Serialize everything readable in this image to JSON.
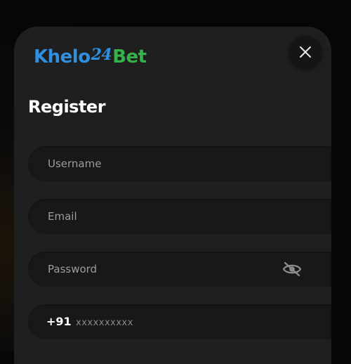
{
  "brand": {
    "part1": "Khelo",
    "part2": "24",
    "part3": "Bet"
  },
  "title": "Register",
  "fields": {
    "username": {
      "placeholder": "Username",
      "value": ""
    },
    "email": {
      "placeholder": "Email",
      "value": ""
    },
    "password": {
      "placeholder": "Password",
      "value": ""
    },
    "phone": {
      "country_code": "+91",
      "placeholder": "xxxxxxxxxx",
      "value": ""
    }
  },
  "icons": {
    "close": "close-icon",
    "password_toggle": "eye-off-icon"
  },
  "colors": {
    "modal_bg": "#1f1f1f",
    "field_bg": "#181818",
    "logo_blue": "#2f8fe0",
    "logo_green": "#33b34a",
    "text": "#ffffff",
    "placeholder": "#9d9d9d"
  }
}
